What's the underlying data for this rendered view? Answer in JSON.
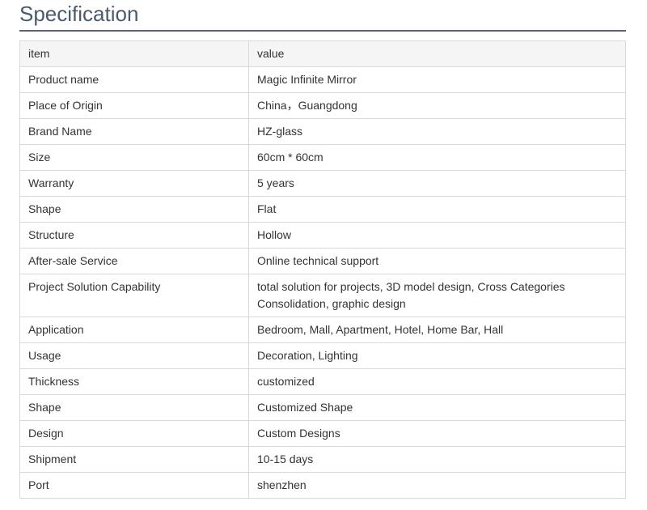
{
  "section": {
    "title": "Specification"
  },
  "table": {
    "header": {
      "item": "item",
      "value": "value"
    },
    "rows": [
      {
        "item": "Product name",
        "value": "Magic Infinite Mirror"
      },
      {
        "item": "Place of Origin",
        "value": "China，Guangdong"
      },
      {
        "item": "Brand Name",
        "value": "HZ-glass"
      },
      {
        "item": "Size",
        "value": "60cm * 60cm"
      },
      {
        "item": "Warranty",
        "value": "5 years"
      },
      {
        "item": "Shape",
        "value": "Flat"
      },
      {
        "item": "Structure",
        "value": "Hollow"
      },
      {
        "item": "After-sale Service",
        "value": "Online technical support"
      },
      {
        "item": "Project Solution Capability",
        "value": "total solution for projects, 3D model design, Cross Categories Consolidation, graphic design"
      },
      {
        "item": "Application",
        "value": "Bedroom, Mall, Apartment, Hotel, Home Bar, Hall"
      },
      {
        "item": "Usage",
        "value": "Decoration, Lighting"
      },
      {
        "item": "Thickness",
        "value": "customized"
      },
      {
        "item": "Shape",
        "value": "Customized Shape"
      },
      {
        "item": "Design",
        "value": "Custom Designs"
      },
      {
        "item": "Shipment",
        "value": "10-15 days"
      },
      {
        "item": "Port",
        "value": "shenzhen"
      }
    ]
  }
}
